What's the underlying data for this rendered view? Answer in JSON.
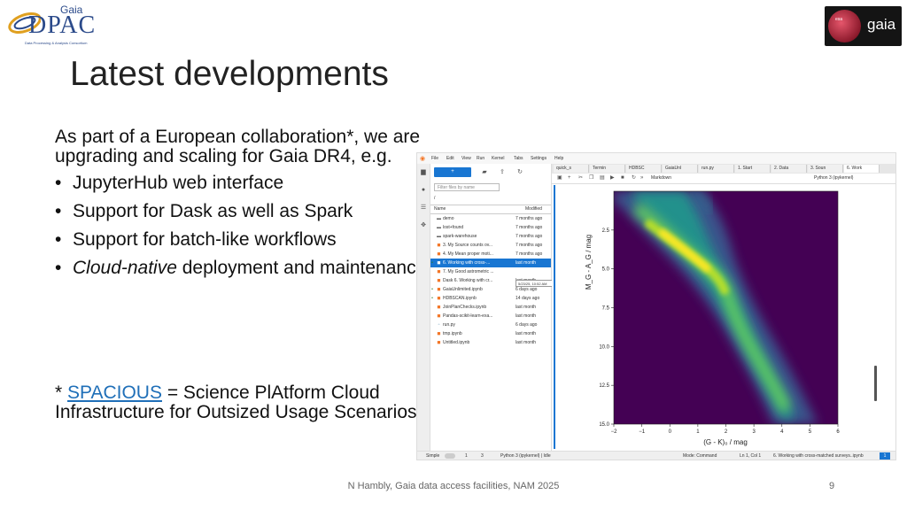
{
  "logos": {
    "dpac": {
      "gaia": "Gaia",
      "name": "DPAC",
      "subtitle": "Data Processing & Analysis Consortium"
    },
    "esa": {
      "esa": "esa",
      "gaia": "gaia"
    }
  },
  "slide": {
    "title": "Latest developments",
    "intro": "As part of a European collaboration*, we are upgrading and scaling for Gaia DR4, e.g.",
    "bullets": [
      {
        "prefix": "",
        "em": "",
        "text": "JupyterHub web interface"
      },
      {
        "prefix": "",
        "em": "",
        "text": "Support for Dask as well as Spark"
      },
      {
        "prefix": "",
        "em": "",
        "text": "Support for batch-like workflows"
      },
      {
        "prefix": "",
        "em": "Cloud-native",
        "text": " deployment and maintenance"
      }
    ],
    "footnote": {
      "star": "* ",
      "link": "SPACIOUS",
      "rest": " = Science PlAtform Cloud Infrastructure for Outsized Usage Scenarios"
    },
    "footer": "N Hambly, Gaia data access facilities, NAM 2025",
    "page_number": "9"
  },
  "jupyter": {
    "menu": [
      "File",
      "Edit",
      "View",
      "Run",
      "Kernel",
      "Tabs",
      "Settings",
      "Help"
    ],
    "new_button": "+",
    "filter_placeholder": "Filter files by name",
    "path": "/",
    "columns": {
      "name": "Name",
      "modified": "Modified"
    },
    "files": [
      {
        "icon": "folder",
        "name": "demo",
        "modified": "7 months ago",
        "running": false,
        "selected": false
      },
      {
        "icon": "folder",
        "name": "lost+found",
        "modified": "7 months ago",
        "running": false,
        "selected": false
      },
      {
        "icon": "folder",
        "name": "spark-warehouse",
        "modified": "7 months ago",
        "running": false,
        "selected": false
      },
      {
        "icon": "notebook",
        "name": "3. My Source counts ov...",
        "modified": "7 months ago",
        "running": false,
        "selected": false
      },
      {
        "icon": "notebook",
        "name": "4. My Mean proper moti...",
        "modified": "7 months ago",
        "running": false,
        "selected": false
      },
      {
        "icon": "notebook",
        "name": "6. Working with cross-...",
        "modified": "last month",
        "running": true,
        "selected": true
      },
      {
        "icon": "notebook",
        "name": "7. My Good astrometric ...",
        "modified": "",
        "running": false,
        "selected": false
      },
      {
        "icon": "notebook",
        "name": "Dask 6. Working with cr...",
        "modified": "last month",
        "running": false,
        "selected": false
      },
      {
        "icon": "notebook",
        "name": "GaiaUnlimited.ipynb",
        "modified": "6 days ago",
        "running": true,
        "selected": false
      },
      {
        "icon": "notebook",
        "name": "HDBSCAN.ipynb",
        "modified": "14 days ago",
        "running": true,
        "selected": false
      },
      {
        "icon": "notebook",
        "name": "JoinPlanChecks.ipynb",
        "modified": "last month",
        "running": false,
        "selected": false
      },
      {
        "icon": "notebook",
        "name": "Pandas-scikit-learn-exa...",
        "modified": "last month",
        "running": false,
        "selected": false
      },
      {
        "icon": "file",
        "name": "run.py",
        "modified": "6 days ago",
        "running": false,
        "selected": false
      },
      {
        "icon": "notebook",
        "name": "tmp.ipynb",
        "modified": "last month",
        "running": false,
        "selected": false
      },
      {
        "icon": "notebook",
        "name": "Untitled.ipynb",
        "modified": "last month",
        "running": false,
        "selected": false
      }
    ],
    "tooltip": "5/23/25, 10:52 AM",
    "tabs": [
      {
        "label": "quick_s",
        "active": false
      },
      {
        "label": "Termin",
        "active": false
      },
      {
        "label": "HDBSC",
        "active": false
      },
      {
        "label": "GaiaUnl",
        "active": false
      },
      {
        "label": "run.py",
        "active": false
      },
      {
        "label": "1. Start",
        "active": false
      },
      {
        "label": "2. Data",
        "active": false
      },
      {
        "label": "3. Soun",
        "active": false
      },
      {
        "label": "6. Work",
        "active": true
      }
    ],
    "cell_type": "Markdown",
    "kernel": "Python 3 (ipykernel)",
    "status": {
      "mode": "Simple",
      "count1": "1",
      "count2": "3",
      "kernel_state": "Python 3 (ipykernel) | Idle",
      "edit_mode": "Mode: Command",
      "position": "Ln 1, Col 1",
      "notebook": "6. Working with cross-matched surveys..ipynb",
      "badge": "1"
    }
  },
  "chart_data": {
    "type": "heatmap",
    "title": "",
    "xlabel": "(G - K)₀ / mag",
    "ylabel": "M_G - A_G / mag",
    "xlim": [
      -2,
      6
    ],
    "ylim": [
      15,
      0
    ],
    "xticks": [
      "−2",
      "−1",
      "0",
      "1",
      "2",
      "3",
      "4",
      "5",
      "6"
    ],
    "yticks": [
      "2.5",
      "5.0",
      "7.5",
      "10.0",
      "12.5",
      "15.0"
    ],
    "colormap": "viridis",
    "background_color": "#440154"
  }
}
